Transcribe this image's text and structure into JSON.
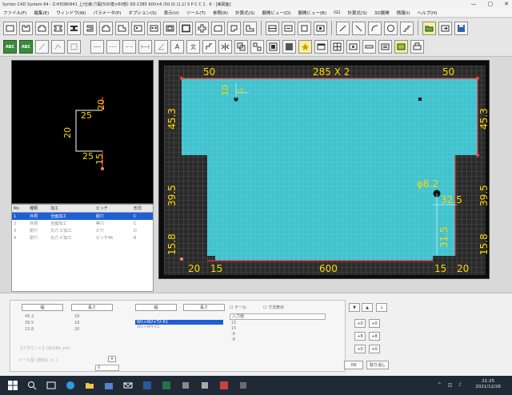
{
  "window": {
    "title": "Syntec CAD System 64 - Z-H5080941 上/仕様:穴開(500角×60部) SD-1385 600×6 (50.0) (1,1) S P C C 1 . 6 - [実図面]",
    "minimize": "—",
    "maximize": "▢",
    "close": "✕"
  },
  "menu": [
    "ファイル(F)",
    "編集(E)",
    "ウィンドウ(W)",
    "パラメータ(P)",
    "オプション(S)",
    "表示(V)",
    "ツール(T)",
    "参照(R)",
    "計算式(S)",
    "展開ビュー(D)",
    "展開ビュー(B)",
    "(G)",
    "計算式(S)",
    "3D展開",
    "情報(I)",
    "ヘルプ(H)"
  ],
  "toolbar2_labels": {
    "btn_a": "ABC",
    "btn_b": "ABC",
    "text_a": "A",
    "text_b": "文"
  },
  "preview": {
    "labels": [
      "25",
      "20",
      "20",
      "25",
      "15"
    ]
  },
  "grid": {
    "headers": [
      "No",
      "種類",
      "加工",
      "ピッチ",
      "形式"
    ],
    "rows": [
      [
        "1",
        "外周",
        "全面加工",
        "耐穴",
        "C"
      ],
      [
        "2",
        "外周",
        "全面加工",
        "等穴",
        "C"
      ],
      [
        "3",
        "耐穴",
        "丸穴 ピ加工",
        "ビ穴",
        "D"
      ],
      [
        "4",
        "耐穴",
        "丸穴 ピ加工",
        "ピッチ46",
        "B"
      ]
    ]
  },
  "drawing": {
    "dims": {
      "top_left": "50",
      "top_center": "285 X 2",
      "top_right": "50",
      "left_top": "45.3",
      "left_mid": "39.5",
      "left_bot": "15.8",
      "right_top": "45.3",
      "right_mid": "39.5",
      "right_bot": "15.8",
      "bot_l1": "20",
      "bot_l2": "15",
      "bot_center": "600",
      "bot_r1": "15",
      "bot_r2": "20",
      "hole_v": "10",
      "hole_h": "10",
      "hole_dia": "φ8.2",
      "dim_32": "32.5",
      "dim_31": "31.5"
    }
  },
  "bottom": {
    "col_a_header": "幅",
    "col_b_header": "長さ",
    "col_a_values": [
      "45.3",
      "39.5",
      "15.8"
    ],
    "col_b_values": [
      "18",
      "18",
      "20"
    ],
    "col_c_header": "幅",
    "col_d_header": "長さ",
    "check_1": "テール",
    "check_2": "寸法表示",
    "input_1": "入力値",
    "list_items": [
      "W1+W2+T2-K1",
      "W1+W4-K1"
    ],
    "list_vals": [
      "15",
      "15",
      "-8",
      "-8"
    ],
    "faded_1": "【アカウント】(ShSRe_est)",
    "faded_2": "メール型 (通知)[ <[ )",
    "spin_value": "0",
    "side_buttons": [
      "+0",
      "+0",
      "+8",
      "+8",
      "+0",
      "+0"
    ],
    "arrow_buttons": [
      "▼",
      "▲",
      "↓"
    ],
    "ok": "OK",
    "cancel": "取り消し"
  },
  "taskbar": {
    "time": "21:25",
    "date": "2021/12/26"
  }
}
